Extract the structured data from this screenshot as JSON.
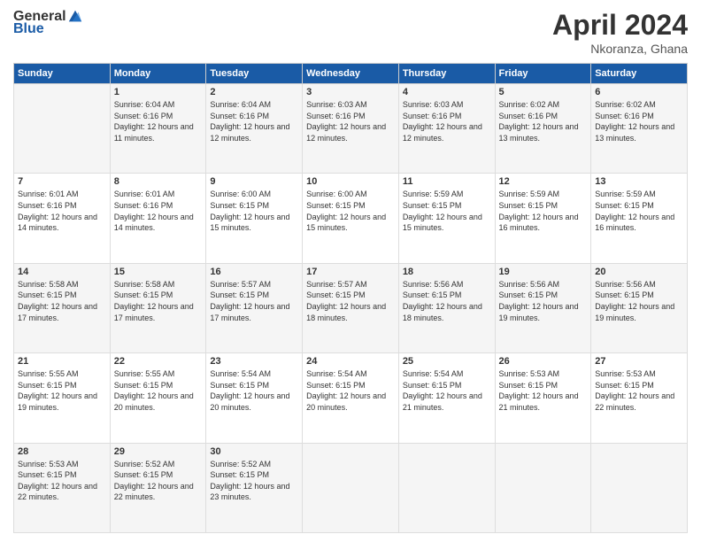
{
  "header": {
    "logo_general": "General",
    "logo_blue": "Blue",
    "month": "April 2024",
    "location": "Nkoranza, Ghana"
  },
  "weekdays": [
    "Sunday",
    "Monday",
    "Tuesday",
    "Wednesday",
    "Thursday",
    "Friday",
    "Saturday"
  ],
  "weeks": [
    [
      {
        "day": "",
        "sunrise": "",
        "sunset": "",
        "daylight": ""
      },
      {
        "day": "1",
        "sunrise": "Sunrise: 6:04 AM",
        "sunset": "Sunset: 6:16 PM",
        "daylight": "Daylight: 12 hours and 11 minutes."
      },
      {
        "day": "2",
        "sunrise": "Sunrise: 6:04 AM",
        "sunset": "Sunset: 6:16 PM",
        "daylight": "Daylight: 12 hours and 12 minutes."
      },
      {
        "day": "3",
        "sunrise": "Sunrise: 6:03 AM",
        "sunset": "Sunset: 6:16 PM",
        "daylight": "Daylight: 12 hours and 12 minutes."
      },
      {
        "day": "4",
        "sunrise": "Sunrise: 6:03 AM",
        "sunset": "Sunset: 6:16 PM",
        "daylight": "Daylight: 12 hours and 12 minutes."
      },
      {
        "day": "5",
        "sunrise": "Sunrise: 6:02 AM",
        "sunset": "Sunset: 6:16 PM",
        "daylight": "Daylight: 12 hours and 13 minutes."
      },
      {
        "day": "6",
        "sunrise": "Sunrise: 6:02 AM",
        "sunset": "Sunset: 6:16 PM",
        "daylight": "Daylight: 12 hours and 13 minutes."
      }
    ],
    [
      {
        "day": "7",
        "sunrise": "Sunrise: 6:01 AM",
        "sunset": "Sunset: 6:16 PM",
        "daylight": "Daylight: 12 hours and 14 minutes."
      },
      {
        "day": "8",
        "sunrise": "Sunrise: 6:01 AM",
        "sunset": "Sunset: 6:16 PM",
        "daylight": "Daylight: 12 hours and 14 minutes."
      },
      {
        "day": "9",
        "sunrise": "Sunrise: 6:00 AM",
        "sunset": "Sunset: 6:15 PM",
        "daylight": "Daylight: 12 hours and 15 minutes."
      },
      {
        "day": "10",
        "sunrise": "Sunrise: 6:00 AM",
        "sunset": "Sunset: 6:15 PM",
        "daylight": "Daylight: 12 hours and 15 minutes."
      },
      {
        "day": "11",
        "sunrise": "Sunrise: 5:59 AM",
        "sunset": "Sunset: 6:15 PM",
        "daylight": "Daylight: 12 hours and 15 minutes."
      },
      {
        "day": "12",
        "sunrise": "Sunrise: 5:59 AM",
        "sunset": "Sunset: 6:15 PM",
        "daylight": "Daylight: 12 hours and 16 minutes."
      },
      {
        "day": "13",
        "sunrise": "Sunrise: 5:59 AM",
        "sunset": "Sunset: 6:15 PM",
        "daylight": "Daylight: 12 hours and 16 minutes."
      }
    ],
    [
      {
        "day": "14",
        "sunrise": "Sunrise: 5:58 AM",
        "sunset": "Sunset: 6:15 PM",
        "daylight": "Daylight: 12 hours and 17 minutes."
      },
      {
        "day": "15",
        "sunrise": "Sunrise: 5:58 AM",
        "sunset": "Sunset: 6:15 PM",
        "daylight": "Daylight: 12 hours and 17 minutes."
      },
      {
        "day": "16",
        "sunrise": "Sunrise: 5:57 AM",
        "sunset": "Sunset: 6:15 PM",
        "daylight": "Daylight: 12 hours and 17 minutes."
      },
      {
        "day": "17",
        "sunrise": "Sunrise: 5:57 AM",
        "sunset": "Sunset: 6:15 PM",
        "daylight": "Daylight: 12 hours and 18 minutes."
      },
      {
        "day": "18",
        "sunrise": "Sunrise: 5:56 AM",
        "sunset": "Sunset: 6:15 PM",
        "daylight": "Daylight: 12 hours and 18 minutes."
      },
      {
        "day": "19",
        "sunrise": "Sunrise: 5:56 AM",
        "sunset": "Sunset: 6:15 PM",
        "daylight": "Daylight: 12 hours and 19 minutes."
      },
      {
        "day": "20",
        "sunrise": "Sunrise: 5:56 AM",
        "sunset": "Sunset: 6:15 PM",
        "daylight": "Daylight: 12 hours and 19 minutes."
      }
    ],
    [
      {
        "day": "21",
        "sunrise": "Sunrise: 5:55 AM",
        "sunset": "Sunset: 6:15 PM",
        "daylight": "Daylight: 12 hours and 19 minutes."
      },
      {
        "day": "22",
        "sunrise": "Sunrise: 5:55 AM",
        "sunset": "Sunset: 6:15 PM",
        "daylight": "Daylight: 12 hours and 20 minutes."
      },
      {
        "day": "23",
        "sunrise": "Sunrise: 5:54 AM",
        "sunset": "Sunset: 6:15 PM",
        "daylight": "Daylight: 12 hours and 20 minutes."
      },
      {
        "day": "24",
        "sunrise": "Sunrise: 5:54 AM",
        "sunset": "Sunset: 6:15 PM",
        "daylight": "Daylight: 12 hours and 20 minutes."
      },
      {
        "day": "25",
        "sunrise": "Sunrise: 5:54 AM",
        "sunset": "Sunset: 6:15 PM",
        "daylight": "Daylight: 12 hours and 21 minutes."
      },
      {
        "day": "26",
        "sunrise": "Sunrise: 5:53 AM",
        "sunset": "Sunset: 6:15 PM",
        "daylight": "Daylight: 12 hours and 21 minutes."
      },
      {
        "day": "27",
        "sunrise": "Sunrise: 5:53 AM",
        "sunset": "Sunset: 6:15 PM",
        "daylight": "Daylight: 12 hours and 22 minutes."
      }
    ],
    [
      {
        "day": "28",
        "sunrise": "Sunrise: 5:53 AM",
        "sunset": "Sunset: 6:15 PM",
        "daylight": "Daylight: 12 hours and 22 minutes."
      },
      {
        "day": "29",
        "sunrise": "Sunrise: 5:52 AM",
        "sunset": "Sunset: 6:15 PM",
        "daylight": "Daylight: 12 hours and 22 minutes."
      },
      {
        "day": "30",
        "sunrise": "Sunrise: 5:52 AM",
        "sunset": "Sunset: 6:15 PM",
        "daylight": "Daylight: 12 hours and 23 minutes."
      },
      {
        "day": "",
        "sunrise": "",
        "sunset": "",
        "daylight": ""
      },
      {
        "day": "",
        "sunrise": "",
        "sunset": "",
        "daylight": ""
      },
      {
        "day": "",
        "sunrise": "",
        "sunset": "",
        "daylight": ""
      },
      {
        "day": "",
        "sunrise": "",
        "sunset": "",
        "daylight": ""
      }
    ]
  ]
}
